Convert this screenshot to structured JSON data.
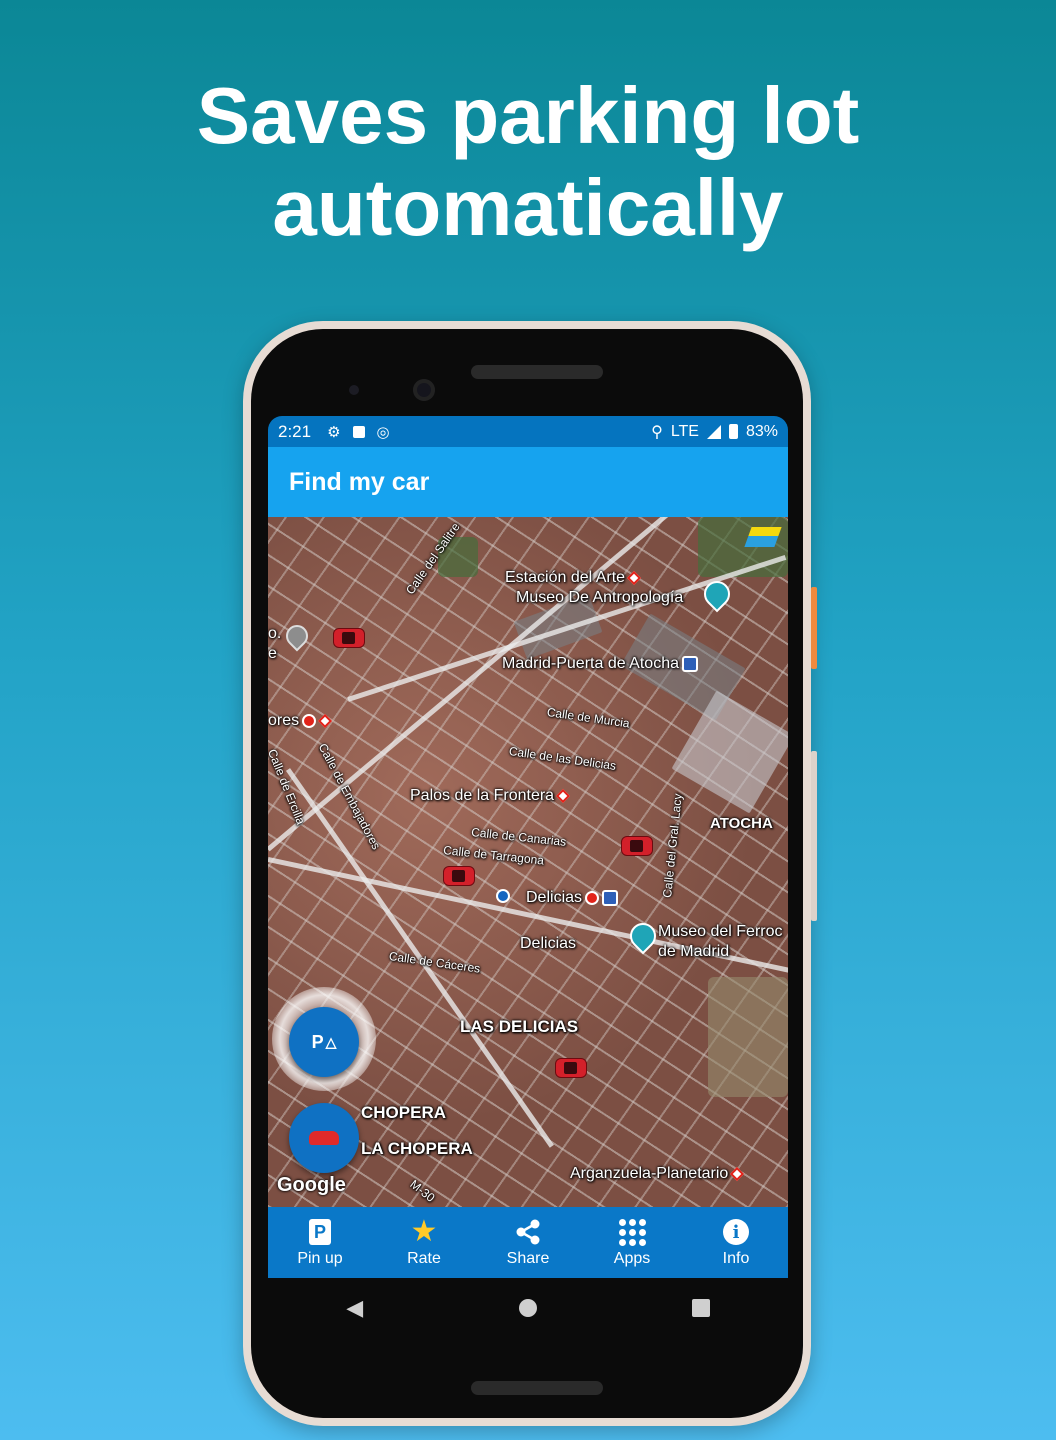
{
  "headline": {
    "line1": "Saves parking lot",
    "line2": "automatically"
  },
  "statusbar": {
    "time": "2:21",
    "network": "LTE",
    "battery": "83%",
    "icons": [
      "settings-icon",
      "a-icon",
      "sync-icon",
      "location-icon",
      "signal-icon",
      "battery-icon"
    ]
  },
  "appbar": {
    "title": "Find my car"
  },
  "map": {
    "labels": {
      "salitre": "Calle del Salitre",
      "estacion": "Estación del Arte",
      "museo_antro": "Museo De Antropología",
      "atocha_station": "Madrid-Puerta de Atocha",
      "murcia": "Calle de Murcia",
      "delicias_street": "Calle de las Delicias",
      "embajadores": "Calle de Embajadores",
      "ercilla": "Calle de Ercilla",
      "palos": "Palos de la Frontera",
      "canarias": "Calle de Canarias",
      "tarragona": "Calle de Tarragona",
      "gral_lacy": "Calle del Gral. Lacy",
      "atocha": "ATOCHA",
      "delicias_metro": "Delicias",
      "museo_ferro_1": "Museo del Ferroc",
      "museo_ferro_2": "de Madrid",
      "delicias2": "Delicias",
      "caceres": "Calle de Cáceres",
      "las_delicias": "LAS DELICIAS",
      "chopera": "CHOPERA",
      "la_chopera": "LA CHOPERA",
      "arganzuela": "Arganzuela-Planetario",
      "m30": "M-30",
      "cut_1": "o.",
      "cut_2": "e",
      "cut_3": "ores"
    },
    "google": "Google",
    "parking_fab_label": "P"
  },
  "bottomnav": {
    "items": [
      {
        "label": "Pin up",
        "icon": "parking-pin-icon"
      },
      {
        "label": "Rate",
        "icon": "star-icon"
      },
      {
        "label": "Share",
        "icon": "share-icon"
      },
      {
        "label": "Apps",
        "icon": "apps-grid-icon"
      },
      {
        "label": "Info",
        "icon": "info-icon"
      }
    ]
  },
  "colors": {
    "statusbar": "#0574bf",
    "appbar": "#16a3ef",
    "bottomnav": "#0a78c8",
    "fab": "#0f71c3",
    "car": "#d3202a"
  }
}
